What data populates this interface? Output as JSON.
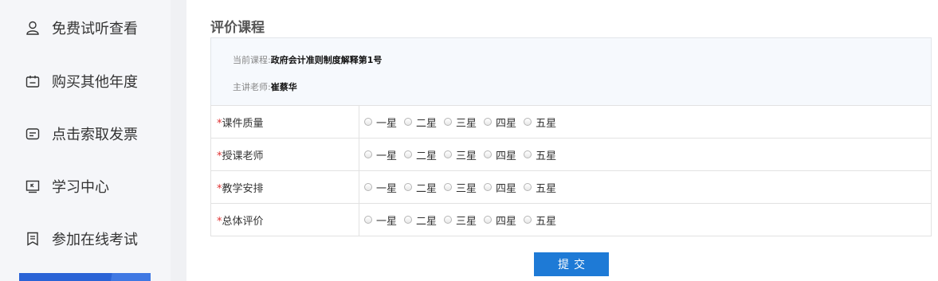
{
  "sidebar": {
    "items": [
      {
        "label": "免费试听查看",
        "icon": "user-icon"
      },
      {
        "label": "购买其他年度",
        "icon": "calendar-icon"
      },
      {
        "label": "点击索取发票",
        "icon": "invoice-icon"
      },
      {
        "label": "学习中心",
        "icon": "monitor-icon"
      },
      {
        "label": "参加在线考试",
        "icon": "exam-icon"
      }
    ],
    "accent_color": "#2a63d6"
  },
  "page": {
    "title": "评价课程",
    "course_label": "当前课程:",
    "course_value": "政府会计准则制度解释第1号",
    "teacher_label": "主讲老师:",
    "teacher_value": "崔蔡华"
  },
  "rating": {
    "required_mark": "*",
    "options": [
      "一星",
      "二星",
      "三星",
      "四星",
      "五星"
    ],
    "criteria": [
      {
        "label": "课件质量"
      },
      {
        "label": "授课老师"
      },
      {
        "label": "教学安排"
      },
      {
        "label": "总体评价"
      }
    ]
  },
  "submit_label": "提交",
  "colors": {
    "primary": "#1e7ad6",
    "required": "#e03131"
  }
}
